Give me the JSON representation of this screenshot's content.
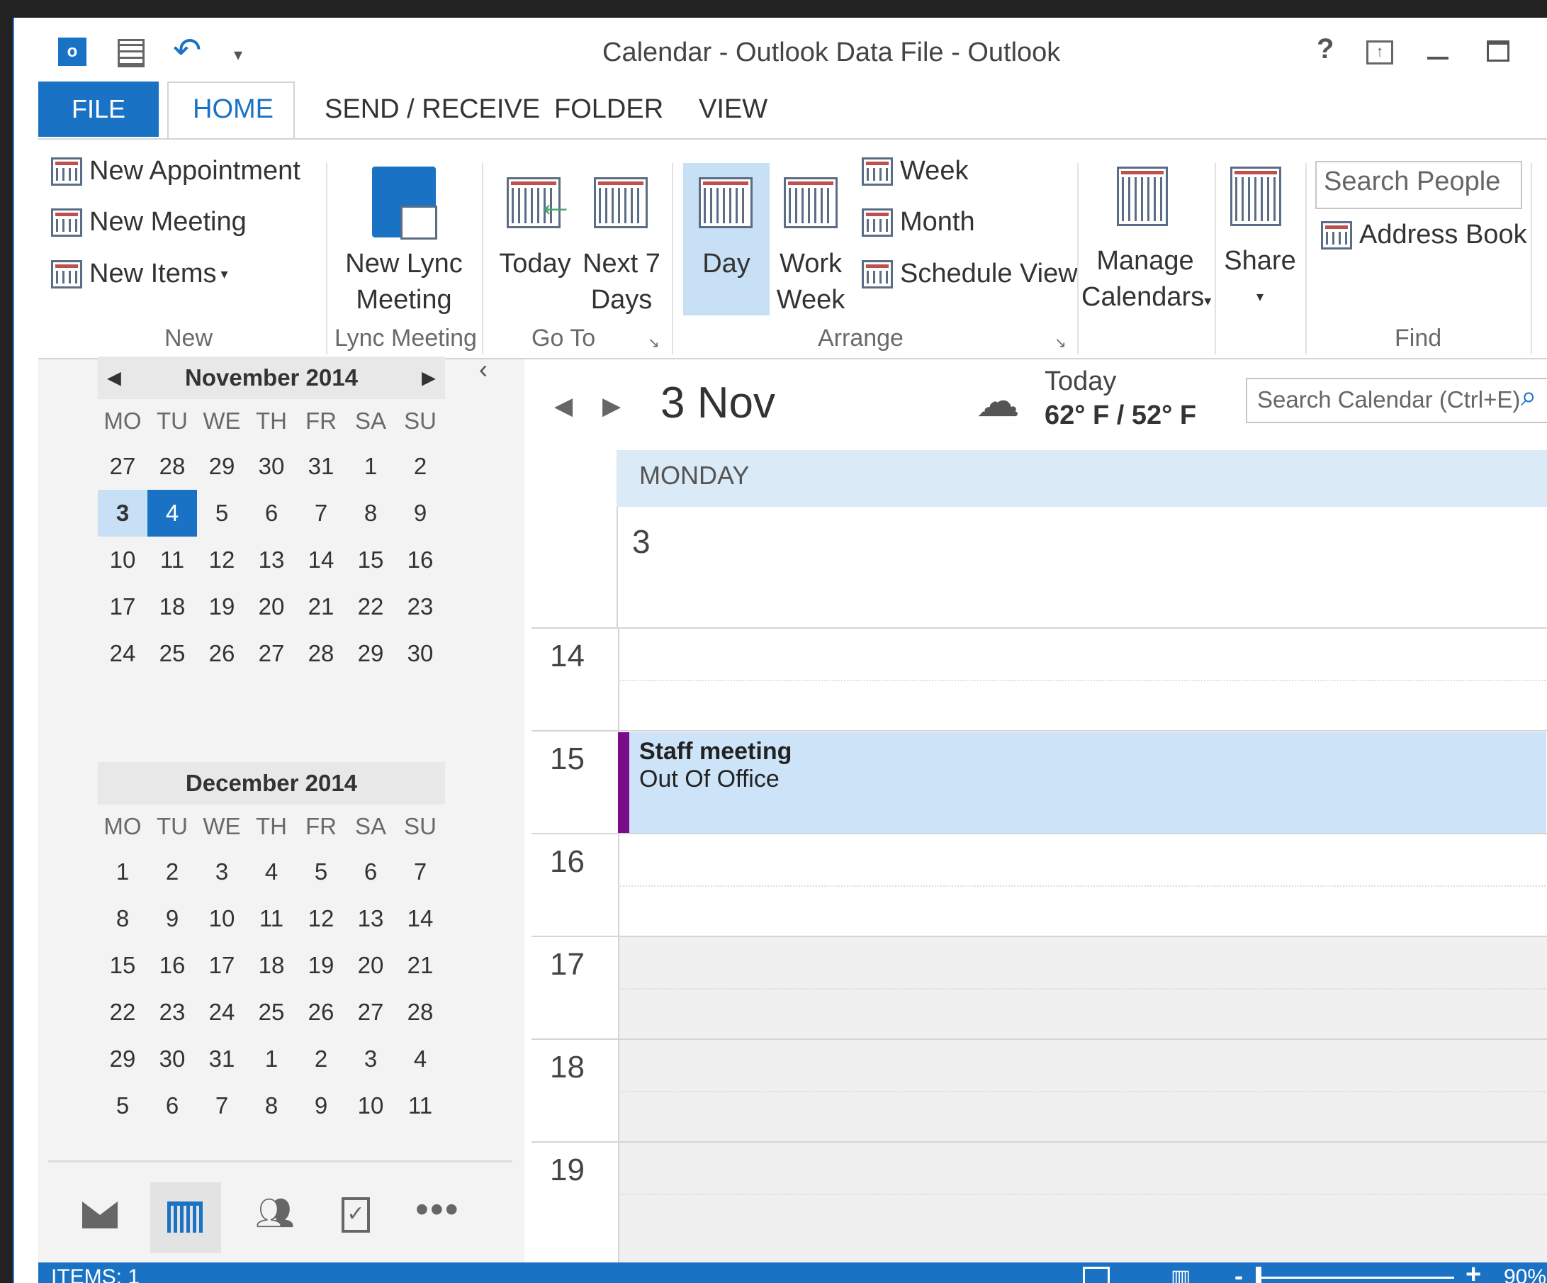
{
  "title": "Calendar - Outlook Data File - Outlook",
  "title_controls": {
    "help": "?"
  },
  "tabs": [
    "FILE",
    "HOME",
    "SEND / RECEIVE",
    "FOLDER",
    "VIEW"
  ],
  "ribbon": {
    "new_appointment": "New Appointment",
    "new_meeting": "New Meeting",
    "new_items": "New Items",
    "new_group": "New",
    "lync_l1": "New Lync",
    "lync_l2": "Meeting",
    "lync_group": "Lync Meeting",
    "today": "Today",
    "next7_l1": "Next 7",
    "next7_l2": "Days",
    "goto_group": "Go To",
    "day": "Day",
    "workweek_l1": "Work",
    "workweek_l2": "Week",
    "week": "Week",
    "month": "Month",
    "schedule_view": "Schedule View",
    "arrange_group": "Arrange",
    "manage_l1": "Manage",
    "manage_l2": "Calendars",
    "share": "Share",
    "search_people": "Search People",
    "address_book": "Address Book",
    "find_group": "Find"
  },
  "mini_calendars": [
    {
      "month": "November 2014",
      "days": [
        "MO",
        "TU",
        "WE",
        "TH",
        "FR",
        "SA",
        "SU"
      ],
      "weeks": [
        [
          "27",
          "28",
          "29",
          "30",
          "31",
          "1",
          "2"
        ],
        [
          "3",
          "4",
          "5",
          "6",
          "7",
          "8",
          "9"
        ],
        [
          "10",
          "11",
          "12",
          "13",
          "14",
          "15",
          "16"
        ],
        [
          "17",
          "18",
          "19",
          "20",
          "21",
          "22",
          "23"
        ],
        [
          "24",
          "25",
          "26",
          "27",
          "28",
          "29",
          "30"
        ]
      ],
      "selected": "3",
      "today": "4"
    },
    {
      "month": "December 2014",
      "days": [
        "MO",
        "TU",
        "WE",
        "TH",
        "FR",
        "SA",
        "SU"
      ],
      "weeks": [
        [
          "1",
          "2",
          "3",
          "4",
          "5",
          "6",
          "7"
        ],
        [
          "8",
          "9",
          "10",
          "11",
          "12",
          "13",
          "14"
        ],
        [
          "15",
          "16",
          "17",
          "18",
          "19",
          "20",
          "21"
        ],
        [
          "22",
          "23",
          "24",
          "25",
          "26",
          "27",
          "28"
        ],
        [
          "29",
          "30",
          "31",
          "1",
          "2",
          "3",
          "4"
        ],
        [
          "5",
          "6",
          "7",
          "8",
          "9",
          "10",
          "11"
        ]
      ]
    }
  ],
  "calendar": {
    "date_heading": "3 Nov",
    "weather_label": "Today",
    "weather_temp": "62° F / 52° F",
    "search_placeholder": "Search Calendar (Ctrl+E)",
    "day_name": "MONDAY",
    "day_number": "3",
    "hours": [
      "14",
      "15",
      "16",
      "17",
      "18",
      "19"
    ],
    "event": {
      "title": "Staff meeting",
      "subtitle": "Out Of Office",
      "color": "#7a0c8a"
    }
  },
  "status": {
    "items": "ITEMS: 1",
    "zoom": "90%"
  },
  "colors": {
    "accent": "#1a72c5",
    "selected_day": "#c8e0f6",
    "event_bg": "#cde4f8"
  },
  "icons": [
    "outlook-icon",
    "mail-icon",
    "calendar-icon",
    "people-icon",
    "tasks-icon",
    "more-icon",
    "cloud-icon",
    "search-icon"
  ]
}
